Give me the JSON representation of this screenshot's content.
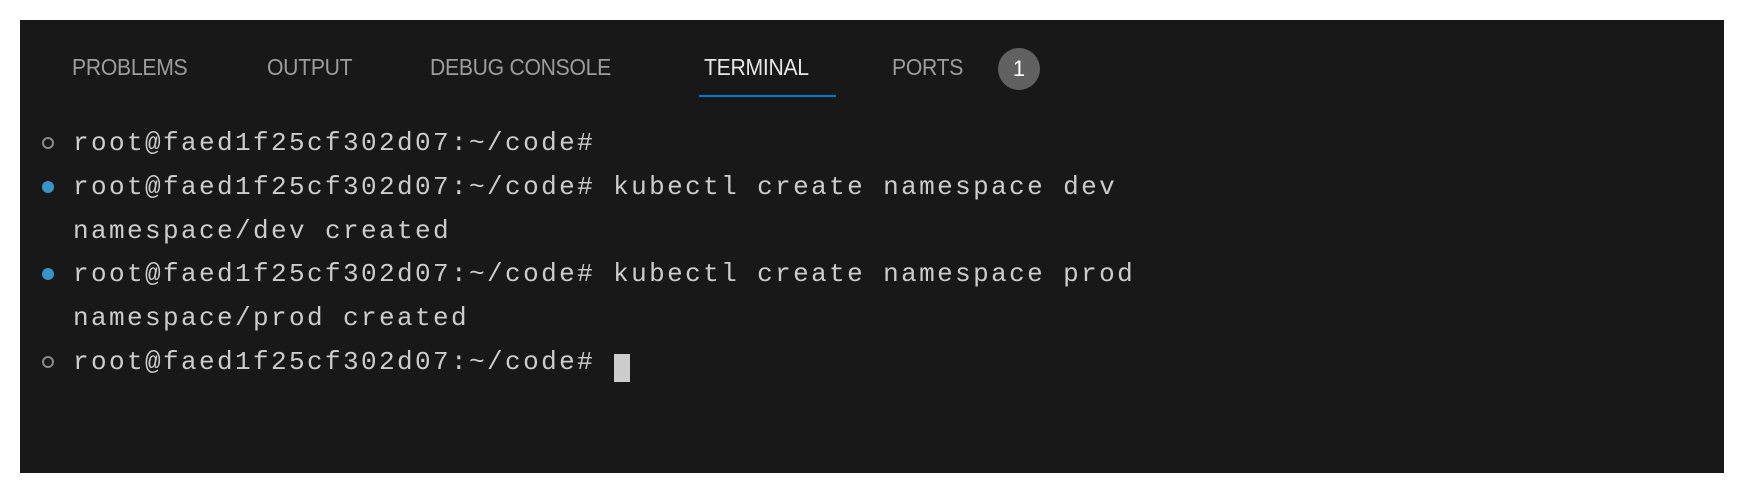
{
  "tabs": [
    {
      "label": "PROBLEMS",
      "active": false
    },
    {
      "label": "OUTPUT",
      "active": false
    },
    {
      "label": "DEBUG CONSOLE",
      "active": false
    },
    {
      "label": "TERMINAL",
      "active": true
    },
    {
      "label": "PORTS",
      "active": false
    }
  ],
  "ports_badge": "1",
  "colors": {
    "background": "#181818",
    "accent": "#0078d4",
    "success_dot": "#8a8a8a",
    "command_dot": "#3794c8"
  },
  "terminal": {
    "lines": [
      {
        "text": "root@faed1f25cf302d07:~/code#",
        "decoration": "circle-outline"
      },
      {
        "text": "root@faed1f25cf302d07:~/code# kubectl create namespace dev",
        "decoration": "circle-filled"
      },
      {
        "text": "namespace/dev created",
        "decoration": "none"
      },
      {
        "text": "root@faed1f25cf302d07:~/code# kubectl create namespace prod",
        "decoration": "circle-filled"
      },
      {
        "text": "namespace/prod created",
        "decoration": "none"
      },
      {
        "text": "root@faed1f25cf302d07:~/code# ",
        "decoration": "circle-outline"
      }
    ]
  }
}
